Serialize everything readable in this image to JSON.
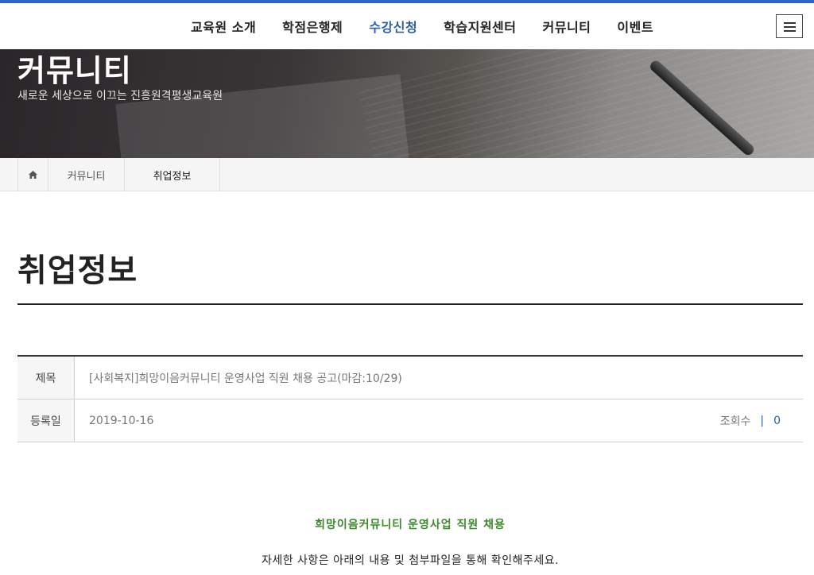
{
  "nav": {
    "items": [
      {
        "label": "교육원 소개"
      },
      {
        "label": "학점은행제"
      },
      {
        "label": "수강신청",
        "active": true
      },
      {
        "label": "학습지원센터"
      },
      {
        "label": "커뮤니티"
      },
      {
        "label": "이벤트"
      }
    ],
    "menu_icon": "hamburger-icon",
    "accent_color": "#2a5ea8"
  },
  "hero": {
    "title": "커뮤니티",
    "subtitle": "새로운 세상으로 이끄는 진흥원격평생교육원"
  },
  "breadcrumb": {
    "home_icon": "home-icon",
    "items": [
      "커뮤니티",
      "취업정보"
    ]
  },
  "page": {
    "title": "취업정보"
  },
  "post": {
    "subject_label": "제목",
    "subject": "[사회복지]희망이음커뮤니티 운영사업 직원 채용 공고(마감:10/29)",
    "date_label": "등록일",
    "date": "2019-10-16",
    "views_label": "조회수",
    "views_separator": "|",
    "views": "0"
  },
  "content": {
    "heading": "희망이음커뮤니티 운영사업 직원 채용",
    "heading_color": "#3b8a2a",
    "text": "자세한 사항은 아래의 내용 및 첨부파일을 통해 확인해주세요."
  }
}
